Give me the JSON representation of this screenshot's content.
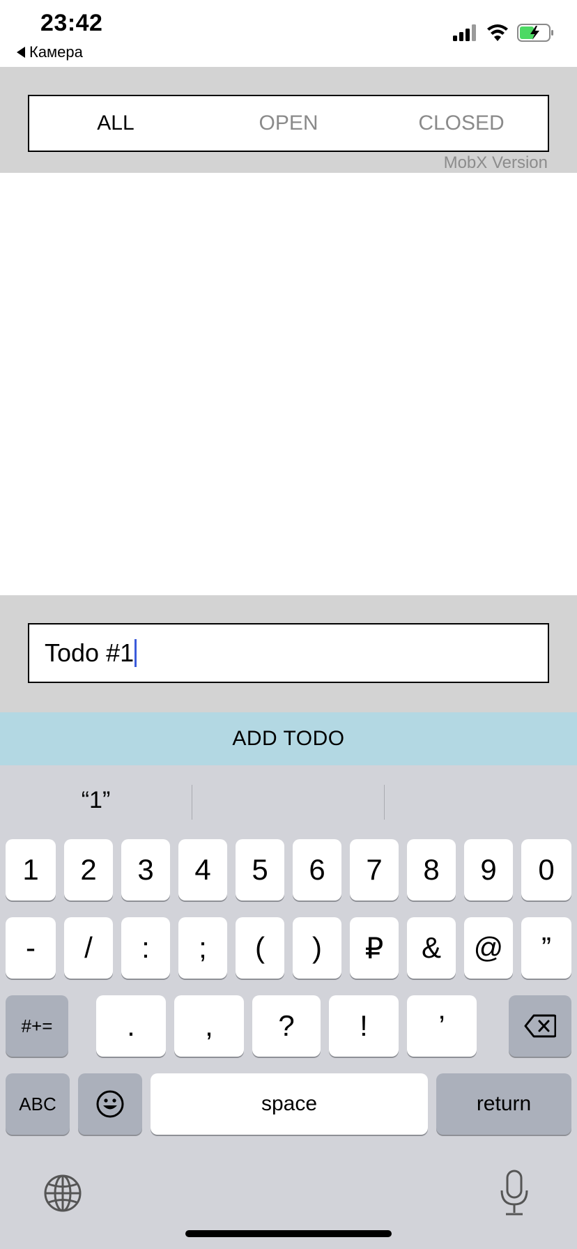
{
  "status": {
    "time": "23:42",
    "back_label": "Камера"
  },
  "filter": {
    "tabs": [
      {
        "label": "ALL",
        "selected": true
      },
      {
        "label": "OPEN",
        "selected": false
      },
      {
        "label": "CLOSED",
        "selected": false
      }
    ],
    "version_label": "MobX Version"
  },
  "input": {
    "value": "Todo #1"
  },
  "add_button": {
    "label": "ADD TODO"
  },
  "keyboard": {
    "suggestions": [
      "“1”",
      "",
      ""
    ],
    "row1": [
      "1",
      "2",
      "3",
      "4",
      "5",
      "6",
      "7",
      "8",
      "9",
      "0"
    ],
    "row2": [
      "-",
      "/",
      ":",
      ";",
      "(",
      ")",
      "₽",
      "&",
      "@",
      "”"
    ],
    "row3": [
      ".",
      ",",
      "?",
      "!",
      "’"
    ],
    "symbols_key": "#+=",
    "abc_key": "ABC",
    "space_key": "space",
    "return_key": "return"
  },
  "colors": {
    "panel_gray": "#d3d3d3",
    "add_button_bg": "#b3d8e3",
    "keyboard_bg": "#d2d3d9",
    "battery_green": "#4cd964",
    "caret_blue": "#3b5bdb"
  }
}
